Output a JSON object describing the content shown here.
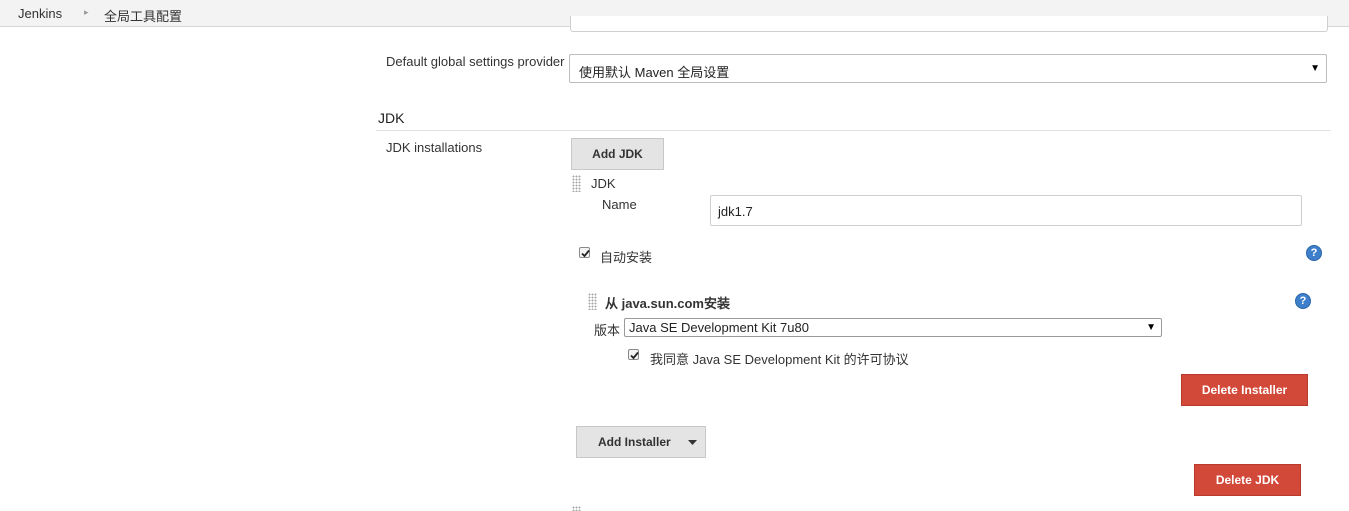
{
  "breadcrumb": {
    "items": [
      "Jenkins",
      "全局工具配置"
    ],
    "separator": "▸"
  },
  "maven": {
    "global_settings_label": "Default global settings provider",
    "global_settings_value": "使用默认 Maven 全局设置"
  },
  "jdk_section": {
    "title": "JDK",
    "installations_label": "JDK installations",
    "add_jdk_label": "Add JDK",
    "entry": {
      "header": "JDK",
      "name_label": "Name",
      "name_value": "jdk1.7",
      "auto_install_label": "自动安装",
      "auto_install_checked": true,
      "installer": {
        "title": "从 java.sun.com安装",
        "version_label": "版本",
        "version_value": "Java SE Development Kit 7u80",
        "license_label": "我同意 Java SE Development Kit 的许可协议",
        "license_checked": true,
        "delete_installer_label": "Delete Installer"
      },
      "add_installer_label": "Add Installer",
      "delete_jdk_label": "Delete JDK"
    }
  },
  "icons": {
    "help": "?",
    "dropdown_arrow": "▼"
  },
  "colors": {
    "danger": "#d24939",
    "help": "#3d7fcb",
    "topbar": "#f3f3f3"
  }
}
